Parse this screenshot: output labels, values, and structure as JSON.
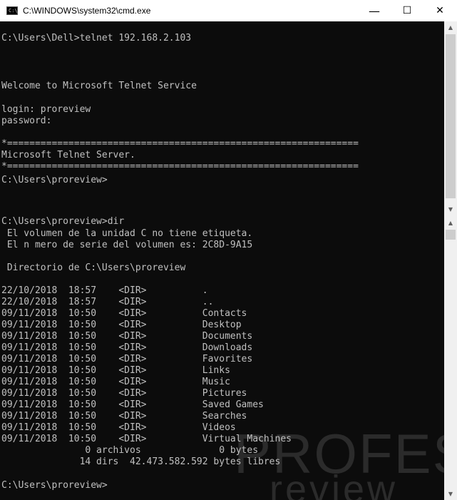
{
  "window": {
    "title": "C:\\WINDOWS\\system32\\cmd.exe",
    "icon": "cmd-icon",
    "icon_label": "C:\\",
    "minimize": "—",
    "maximize": "☐",
    "close": "✕"
  },
  "watermark": {
    "line1": "PROFESIONAL",
    "line2": "review"
  },
  "top_pane": {
    "lines": [
      "C:\\Users\\Dell>telnet 192.168.2.103",
      "Welcome to Microsoft Telnet Service",
      "login: proreview",
      "password:",
      "*===============================================================",
      "Microsoft Telnet Server.",
      "*===============================================================",
      "C:\\Users\\proreview>"
    ]
  },
  "bottom_pane": {
    "lines": [
      "C:\\Users\\proreview>dir",
      " El volumen de la unidad C no tiene etiqueta.",
      " El n mero de serie del volumen es: 2C8D-9A15",
      " Directorio de C:\\Users\\proreview",
      "22/10/2018  18:57    <DIR>          .",
      "22/10/2018  18:57    <DIR>          ..",
      "09/11/2018  10:50    <DIR>          Contacts",
      "09/11/2018  10:50    <DIR>          Desktop",
      "09/11/2018  10:50    <DIR>          Documents",
      "09/11/2018  10:50    <DIR>          Downloads",
      "09/11/2018  10:50    <DIR>          Favorites",
      "09/11/2018  10:50    <DIR>          Links",
      "09/11/2018  10:50    <DIR>          Music",
      "09/11/2018  10:50    <DIR>          Pictures",
      "09/11/2018  10:50    <DIR>          Saved Games",
      "09/11/2018  10:50    <DIR>          Searches",
      "09/11/2018  10:50    <DIR>          Videos",
      "09/11/2018  10:50    <DIR>          Virtual Machines",
      "               0 archivos              0 bytes",
      "              14 dirs  42.473.582.592 bytes libres",
      "C:\\Users\\proreview>"
    ]
  },
  "scrollbar": {
    "up": "▲",
    "down": "▼"
  }
}
